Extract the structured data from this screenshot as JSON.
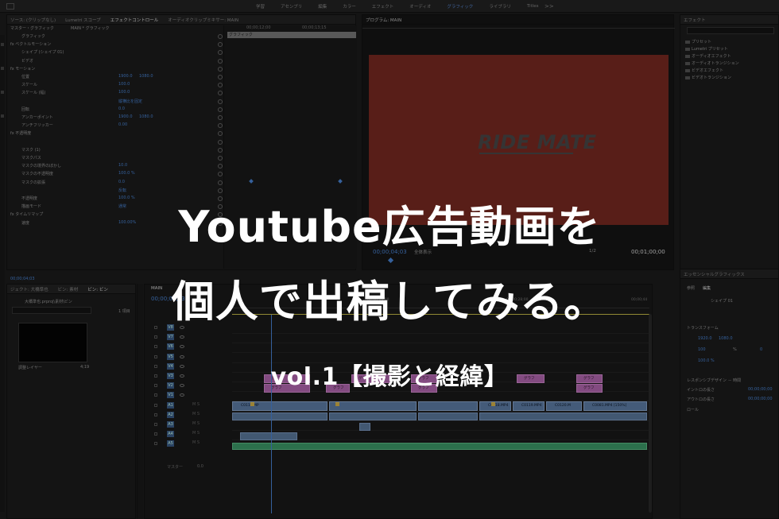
{
  "workspaces": {
    "tabs": [
      "学習",
      "アセンブリ",
      "編集",
      "カラー",
      "エフェクト",
      "オーディオ",
      "グラフィック",
      "ライブラリ",
      "Titles"
    ],
    "active": "グラフィック",
    "more": ">>"
  },
  "effect_controls": {
    "tabs": [
      "ソース: (クリップなし)",
      "Lumetri スコープ",
      "エフェクトコントロール",
      "オーディオクリップミキサー: MAIN"
    ],
    "active_tab": "エフェクトコントロール",
    "source_label": "マスター・グラフィック",
    "clip_label": "MAIN * グラフィック",
    "clip_bar": "グラフィック",
    "times": [
      "00;00;12;00",
      "00;00;13;15"
    ],
    "rows": [
      {
        "label": "グラフィック",
        "value": "",
        "value2": ""
      },
      {
        "label": "fx ベクトルモーション",
        "value": "",
        "value2": ""
      },
      {
        "label": "シェイプ (シェイプ 01)",
        "value": "",
        "value2": ""
      },
      {
        "label": "ビデオ",
        "value": "",
        "value2": ""
      },
      {
        "label": "fx モーション",
        "value": "",
        "value2": ""
      },
      {
        "label": "位置",
        "value": "1900.0",
        "value2": "1080.0"
      },
      {
        "label": "スケール",
        "value": "100.0",
        "value2": ""
      },
      {
        "label": "スケール (幅)",
        "value": "100.0",
        "value2": ""
      },
      {
        "label": "",
        "value": "縦横比を固定",
        "value2": ""
      },
      {
        "label": "回転",
        "value": "0.0",
        "value2": ""
      },
      {
        "label": "アンカーポイント",
        "value": "1900.0",
        "value2": "1080.0"
      },
      {
        "label": "アンチフリッカー",
        "value": "0.00",
        "value2": ""
      },
      {
        "label": "fx 不透明度",
        "value": "",
        "value2": ""
      },
      {
        "label": "",
        "value": "",
        "value2": ""
      },
      {
        "label": "マスク (1)",
        "value": "",
        "value2": ""
      },
      {
        "label": "マスクパス",
        "value": "",
        "value2": ""
      },
      {
        "label": "マスクの境界のぼかし",
        "value": "10.0",
        "value2": ""
      },
      {
        "label": "マスクの不透明度",
        "value": "100.0 %",
        "value2": ""
      },
      {
        "label": "マスクの拡張",
        "value": "0.0",
        "value2": ""
      },
      {
        "label": "",
        "value": "反転",
        "value2": ""
      },
      {
        "label": "不透明度",
        "value": "100.0 %",
        "value2": ""
      },
      {
        "label": "描画モード",
        "value": "通常",
        "value2": ""
      },
      {
        "label": "fx タイムリマップ",
        "value": "",
        "value2": ""
      },
      {
        "label": "速度",
        "value": "100.00%",
        "value2": ""
      }
    ],
    "footer_time": "00;00;04;03"
  },
  "program": {
    "title": "プログラム: MAIN",
    "logo": "RIDE MATE",
    "timecode": "00;00;04;03",
    "fit": "全体表示",
    "quality": "1/2",
    "duration": "00;01;00;00"
  },
  "fx_browser": {
    "title": "エフェクト",
    "items": [
      "プリセット",
      "Lumetri プリセット",
      "オーディオエフェクト",
      "オーディオトランジション",
      "ビデオエフェクト",
      "ビデオトランジション"
    ]
  },
  "essential": {
    "title": "エッセンシャルグラフィックス",
    "tabs": [
      "参照",
      "編集"
    ],
    "layer": "シェイプ 01",
    "transform": "トランスフォーム",
    "pos_x": "1920.0",
    "pos_y": "1080.0",
    "scale": "100",
    "scale_unit": "%",
    "rotation": "0",
    "opacity": "100.0 %",
    "responsive": "レスポンシブデザイン － 時間",
    "intro": "イントロの長さ",
    "intro_val": "00;00;00;00",
    "outro": "アウトロの長さ",
    "outro_val": "00;00;00;00",
    "roll": "ロール"
  },
  "project": {
    "tabs": [
      "ジェクト: 大橋準也",
      "ビン: 素材",
      "ビン: ビン"
    ],
    "path": "大橋準也.prproj\\素材\\ビン",
    "count": "1 項目",
    "item_label": "調整レイヤー",
    "item_duration": "4;19"
  },
  "timeline": {
    "tab": "MAIN",
    "time": "00;00;04;03",
    "ruler": [
      "00;00;14;00",
      "00;00;28;00",
      "00;00;44"
    ],
    "video_tracks": [
      "V8",
      "V7",
      "V6",
      "V5",
      "V4",
      "V3",
      "V2",
      "V1"
    ],
    "audio_tracks": [
      "A1",
      "A2",
      "A3",
      "A4",
      "A5"
    ],
    "master": "マスター",
    "master_val": "0.0",
    "pink_clips": [
      "グラフ",
      "グラフ",
      "グラフ",
      "グラフ",
      "グラフ",
      "グラフ",
      "グラフ",
      "グラフ",
      "グラフ"
    ],
    "blue_clips": [
      "C0118.MP",
      "C0118.MP4",
      "C0119.MP4",
      "C0120.M",
      "C0081.MP4 [150%]"
    ]
  },
  "overlay": {
    "line1": "Youtube広告動画を",
    "line2": "個人で出稿してみる。",
    "line3": "vol.1【撮影と経緯】"
  }
}
